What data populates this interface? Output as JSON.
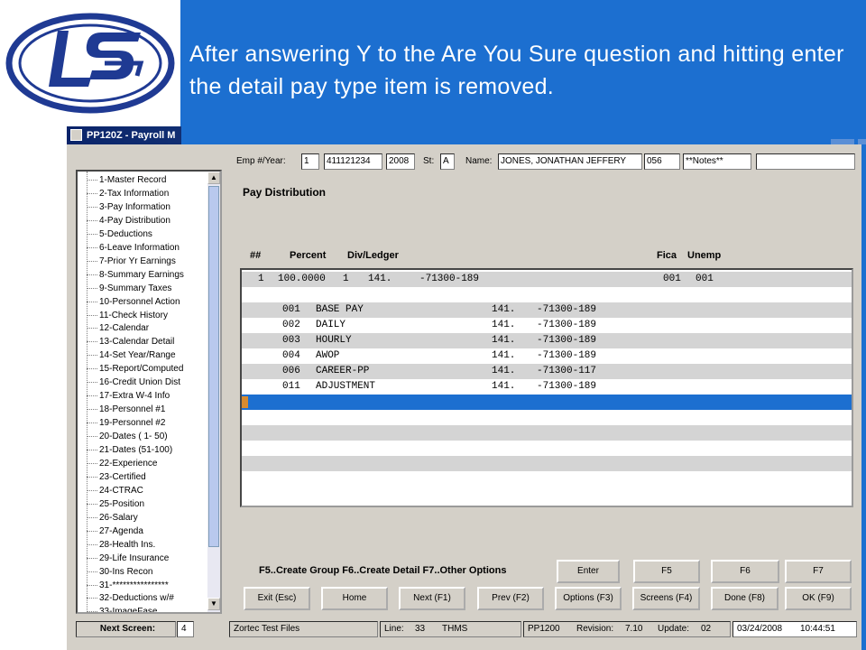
{
  "caption": "After answering Y to the Are You Sure question and hitting enter the detail pay type item is removed.",
  "window": {
    "title": "PP120Z - Payroll M"
  },
  "nav": {
    "items": [
      "1-Master Record",
      "2-Tax Information",
      "3-Pay Information",
      "4-Pay Distribution",
      "5-Deductions",
      "6-Leave Information",
      "7-Prior Yr Earnings",
      "8-Summary Earnings",
      "9-Summary Taxes",
      "10-Personnel Action",
      "11-Check History",
      "12-Calendar",
      "13-Calendar Detail",
      "14-Set Year/Range",
      "15-Report/Computed",
      "16-Credit Union Dist",
      "17-Extra W-4 Info",
      "18-Personnel #1",
      "19-Personnel #2",
      "20-Dates ( 1- 50)",
      "21-Dates (51-100)",
      "22-Experience",
      "23-Certified",
      "24-CTRAC",
      "25-Position",
      "26-Salary",
      "27-Agenda",
      "28-Health Ins.",
      "29-Life Insurance",
      "30-Ins Recon",
      "31-****************",
      "32-Deductions w/#",
      "33-ImageFase"
    ]
  },
  "header": {
    "emp_label": "Emp #/Year:",
    "emp_num": "1",
    "ssn": "411121234",
    "year": "2008",
    "st_label": "St:",
    "st": "A",
    "name_label": "Name:",
    "name": "JONES, JONATHAN JEFFERY",
    "code": "056",
    "notes": "**Notes**",
    "extra": ""
  },
  "panel": {
    "title": "Pay Distribution",
    "columns": {
      "num": "##",
      "percent": "Percent",
      "div": "Div/Ledger",
      "fica": "Fica",
      "unemp": "Unemp"
    }
  },
  "grid": {
    "summary": {
      "num": "1",
      "percent": "100.0000",
      "div": "1",
      "fund": "141.",
      "acct": "-71300-189",
      "fica": "001",
      "unemp": "001"
    },
    "details": [
      {
        "code": "001",
        "desc": "BASE PAY",
        "fund": "141.",
        "acct": "-71300-189"
      },
      {
        "code": "002",
        "desc": "DAILY",
        "fund": "141.",
        "acct": "-71300-189"
      },
      {
        "code": "003",
        "desc": "HOURLY",
        "fund": "141.",
        "acct": "-71300-189"
      },
      {
        "code": "004",
        "desc": "AWOP",
        "fund": "141.",
        "acct": "-71300-189"
      },
      {
        "code": "006",
        "desc": "CAREER-PP",
        "fund": "141.",
        "acct": "-71300-117"
      },
      {
        "code": "011",
        "desc": "ADJUSTMENT",
        "fund": "141.",
        "acct": "-71300-189"
      }
    ],
    "colors": {
      "stripe": "#d4d4d4",
      "selected": "#1c6fd0",
      "marker": "#d98b2e"
    }
  },
  "fkeys_text": "F5..Create Group  F6..Create Detail  F7..Other Options",
  "buttons": {
    "enter": "Enter",
    "f5": "F5",
    "f6": "F6",
    "f7": "F7",
    "exit": "Exit (Esc)",
    "home": "Home",
    "next": "Next (F1)",
    "prev": "Prev (F2)",
    "options": "Options (F3)",
    "screens": "Screens (F4)",
    "done": "Done (F8)",
    "ok": "OK (F9)"
  },
  "status": {
    "next_screen_label": "Next Screen:",
    "next_screen_value": "4",
    "db": "Zortec Test Files",
    "line_label": "Line:",
    "line": "33",
    "user": "THMS",
    "program": "PP1200",
    "revision_label": "Revision:",
    "revision": "7.10",
    "update_label": "Update:",
    "update": "02",
    "date": "03/24/2008",
    "time": "10:44:51"
  },
  "colors": {
    "banner": "#1c6fd0",
    "logo": "#1f3a93",
    "window_bg": "#d4d0c8"
  }
}
